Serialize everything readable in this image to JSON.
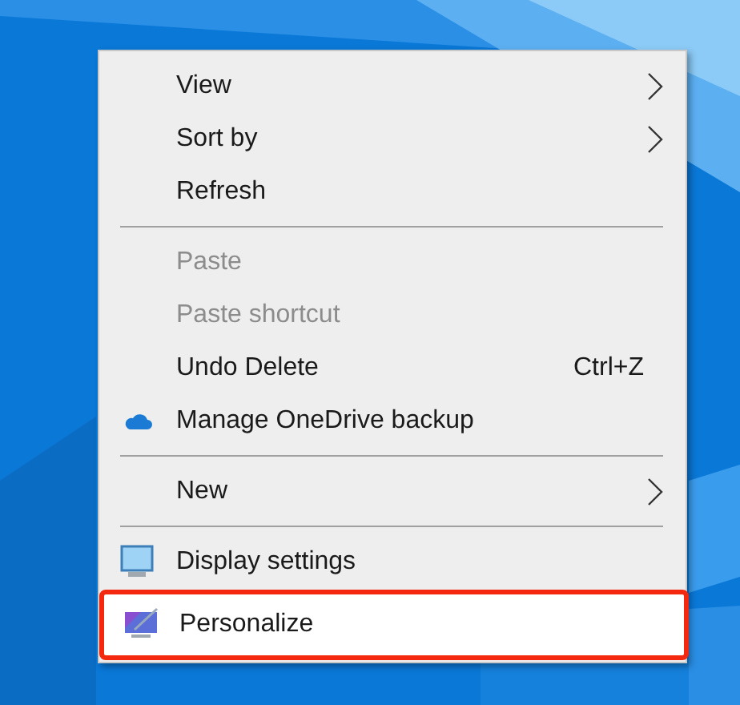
{
  "context_menu": {
    "items": [
      {
        "kind": "item",
        "label": "View",
        "submenu": true,
        "disabled": false,
        "highlighted": false
      },
      {
        "kind": "item",
        "label": "Sort by",
        "submenu": true,
        "disabled": false,
        "highlighted": false
      },
      {
        "kind": "item",
        "label": "Refresh",
        "submenu": false,
        "disabled": false,
        "highlighted": false
      },
      {
        "kind": "separator"
      },
      {
        "kind": "item",
        "label": "Paste",
        "submenu": false,
        "disabled": true,
        "highlighted": false
      },
      {
        "kind": "item",
        "label": "Paste shortcut",
        "submenu": false,
        "disabled": true,
        "highlighted": false
      },
      {
        "kind": "item",
        "label": "Undo Delete",
        "shortcut": "Ctrl+Z",
        "submenu": false,
        "disabled": false,
        "highlighted": false
      },
      {
        "kind": "cloud",
        "label": "Manage OneDrive backup",
        "submenu": false,
        "disabled": false,
        "highlighted": false
      },
      {
        "kind": "separator"
      },
      {
        "kind": "item",
        "label": "New",
        "submenu": true,
        "disabled": false,
        "highlighted": false
      },
      {
        "kind": "separator"
      },
      {
        "kind": "monitor",
        "label": "Display settings",
        "submenu": false,
        "disabled": false,
        "highlighted": false
      },
      {
        "kind": "personalize",
        "label": "Personalize",
        "submenu": false,
        "disabled": false,
        "highlighted": true
      }
    ]
  }
}
